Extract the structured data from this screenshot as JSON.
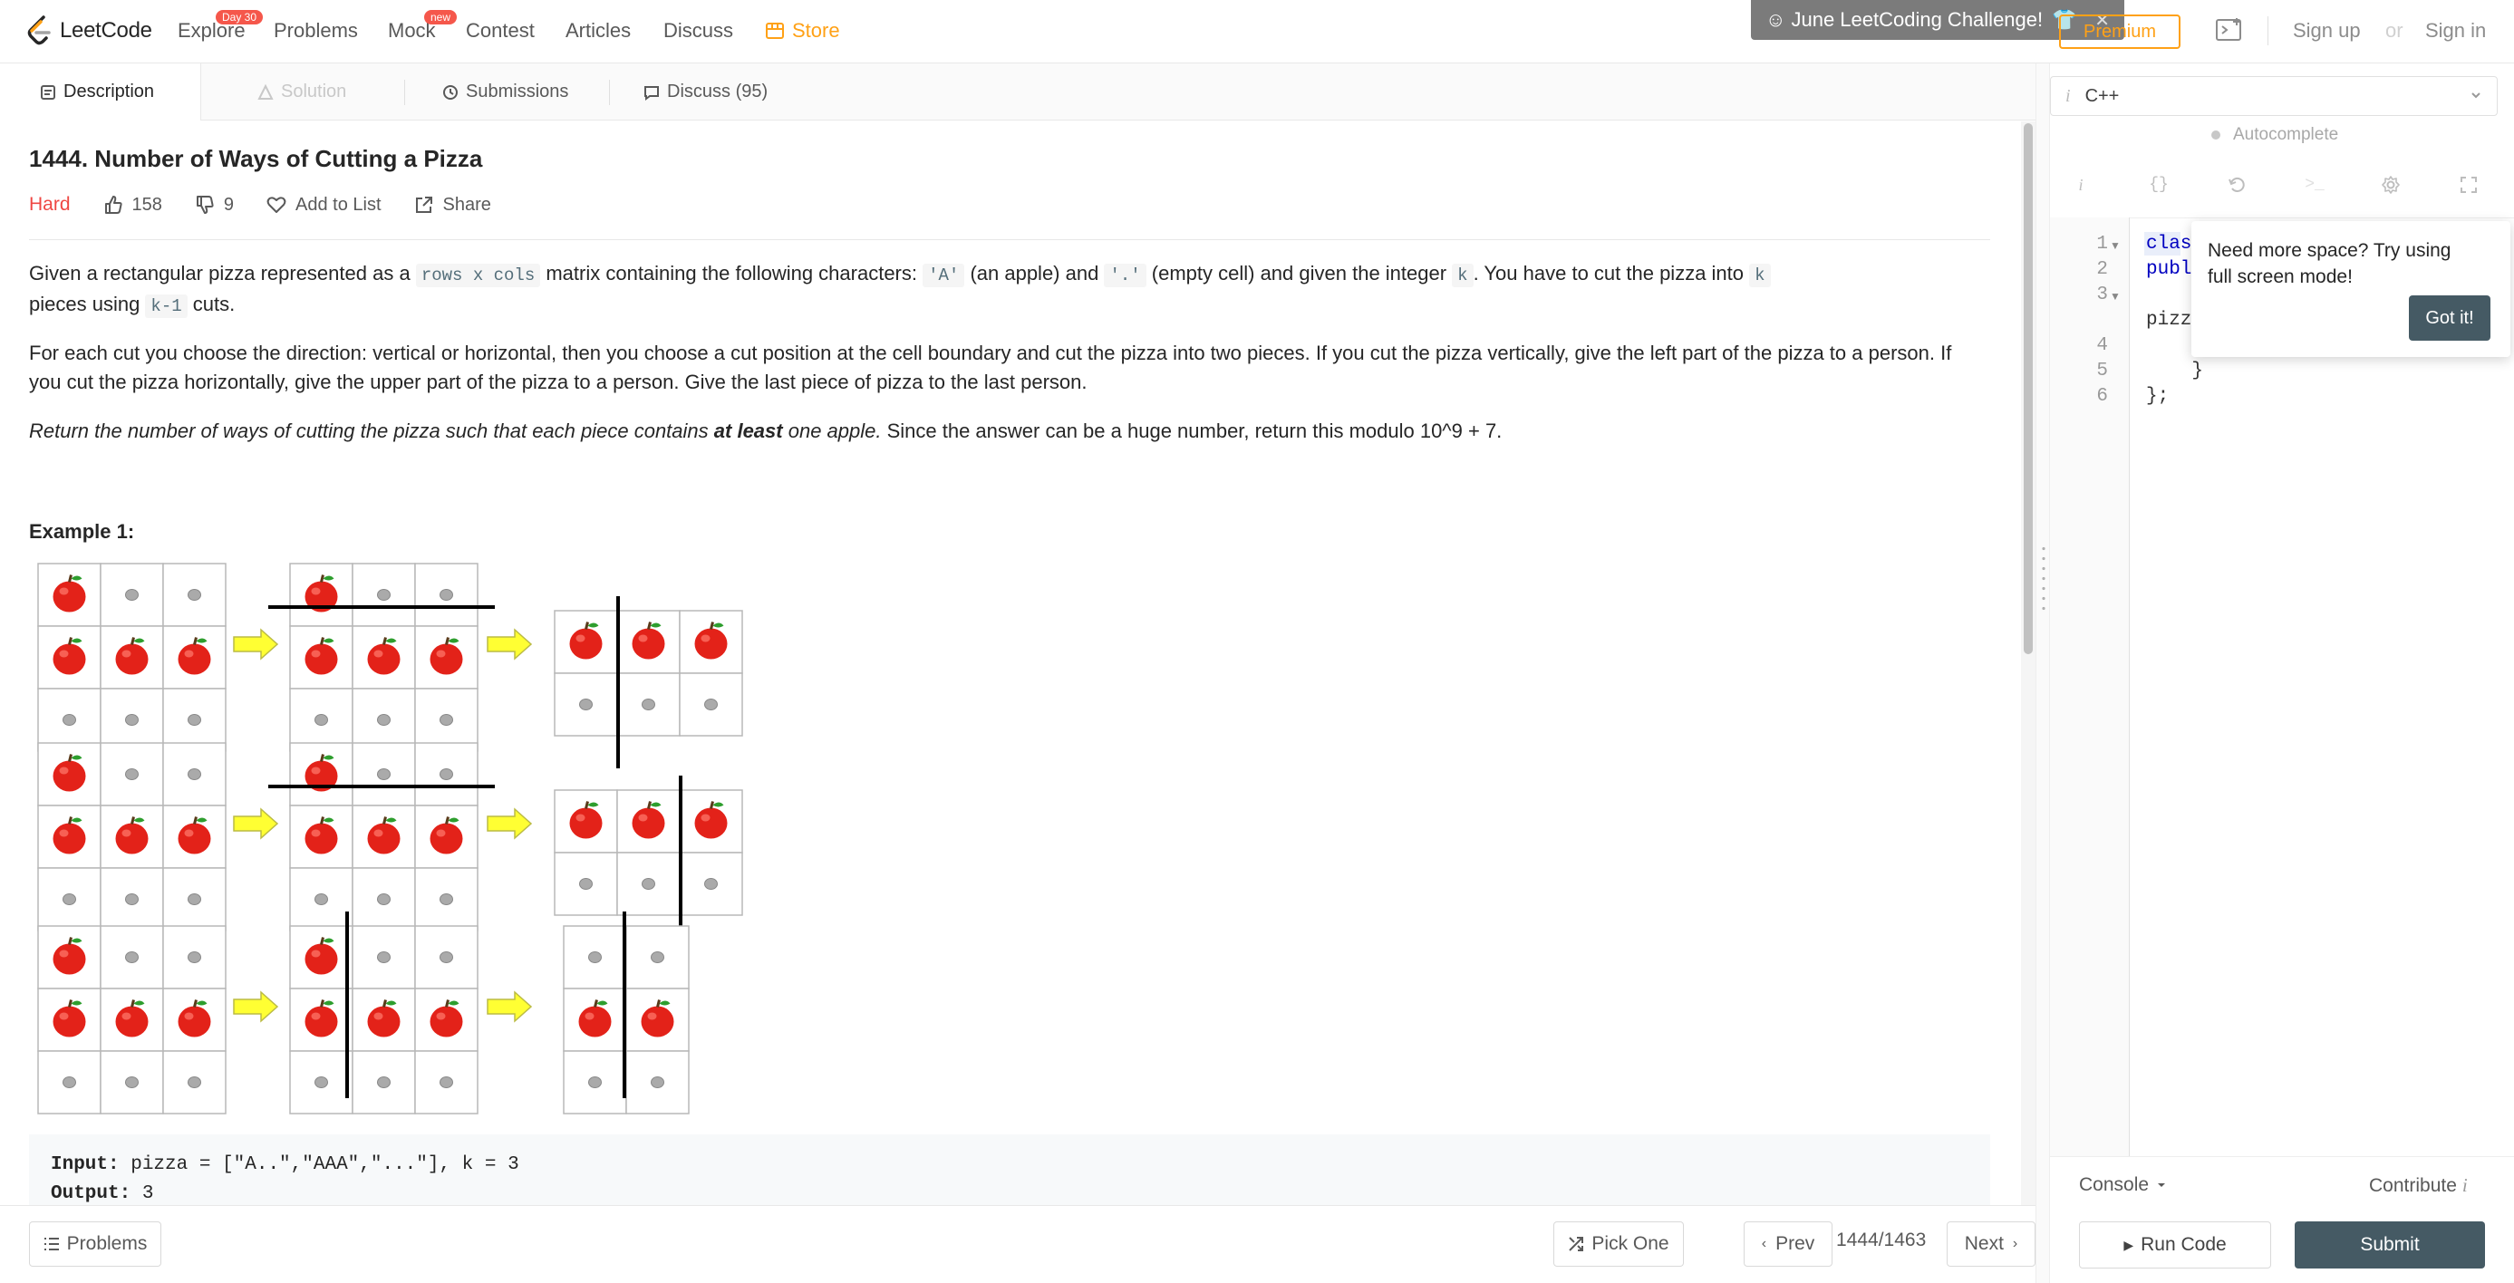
{
  "nav": {
    "logo_text": "LeetCode",
    "explore": "Explore",
    "explore_badge": "Day 30",
    "problems": "Problems",
    "mock": "Mock",
    "mock_badge": "new",
    "contest": "Contest",
    "articles": "Articles",
    "discuss": "Discuss",
    "store": "Store",
    "promo": "June LeetCoding Challenge!",
    "premium": "Premium",
    "sign_up": "Sign up",
    "or": "or",
    "sign_in": "Sign in"
  },
  "tabs": {
    "description": "Description",
    "solution": "Solution",
    "submissions": "Submissions",
    "discuss": "Discuss (95)"
  },
  "problem": {
    "title": "1444. Number of Ways of Cutting a Pizza",
    "difficulty": "Hard",
    "likes": "158",
    "dislikes": "9",
    "add_to_list": "Add to List",
    "share": "Share",
    "p1_a": "Given a rectangular pizza represented as a ",
    "p1_code1": "rows x cols",
    "p1_b": " matrix containing the following characters: ",
    "p1_code2": "'A'",
    "p1_c": " (an apple) and ",
    "p1_code3": "'.'",
    "p1_d": " (empty cell) and given the integer ",
    "p1_code4": "k",
    "p1_e": ". You have to cut the pizza into ",
    "p1_code5": "k",
    "p1_f": "pieces using ",
    "p1_code6": "k-1",
    "p1_g": " cuts.",
    "p2": "For each cut you choose the direction: vertical or horizontal, then you choose a cut position at the cell boundary and cut the pizza into two pieces. If you cut the pizza vertically, give the left part of the pizza to a person. If you cut the pizza horizontally, give the upper part of the pizza to a person. Give the last piece of pizza to the last person.",
    "p3_a": "Return the number of ways of cutting the pizza such that each piece contains ",
    "p3_b": "at least",
    "p3_c": " one apple.",
    "p3_d": " Since the answer can be a huge number, return this modulo 10^9 + 7.",
    "example_title": "Example 1:",
    "input_label": "Input:",
    "input_value": " pizza = [\"A..\",\"AAA\",\"...\"], k = 3",
    "output_label": "Output:",
    "output_value": " 3"
  },
  "bottom": {
    "problems": "Problems",
    "pick_one": "Pick One",
    "prev": "Prev",
    "pager": "1444/1463",
    "next": "Next"
  },
  "editor": {
    "language": "C++",
    "lang_info": "i",
    "autocomplete": "Autocomplete",
    "lines": [
      "1",
      "2",
      "3",
      "4",
      "5",
      "6"
    ],
    "code": [
      "clas",
      "publ",
      "",
      "pizz",
      "",
      "    }",
      "};"
    ],
    "tooltip_text": "Need more space? Try using full screen mode!",
    "got_it": "Got it!",
    "console": "Console",
    "contribute": "Contribute",
    "contribute_info": "i",
    "run_code": "Run Code",
    "submit": "Submit"
  },
  "colors": {
    "accent": "#ffa116",
    "hard": "#ef4743",
    "primary_dark": "#455a64",
    "apple_red": "#e32219",
    "arrow_yellow": "#ffff33"
  },
  "icons": [
    "leetcode-logo",
    "store-icon",
    "description-icon",
    "lock-icon",
    "clock-icon",
    "comment-icon",
    "thumbs-up-icon",
    "thumbs-down-icon",
    "heart-icon",
    "share-icon",
    "list-icon",
    "shuffle-icon",
    "chevron-left-icon",
    "chevron-right-icon",
    "play-icon",
    "caret-down-icon",
    "info-icon",
    "braces-icon",
    "reset-icon",
    "terminal-icon",
    "settings-icon",
    "fullscreen-icon",
    "debugger-icon"
  ]
}
